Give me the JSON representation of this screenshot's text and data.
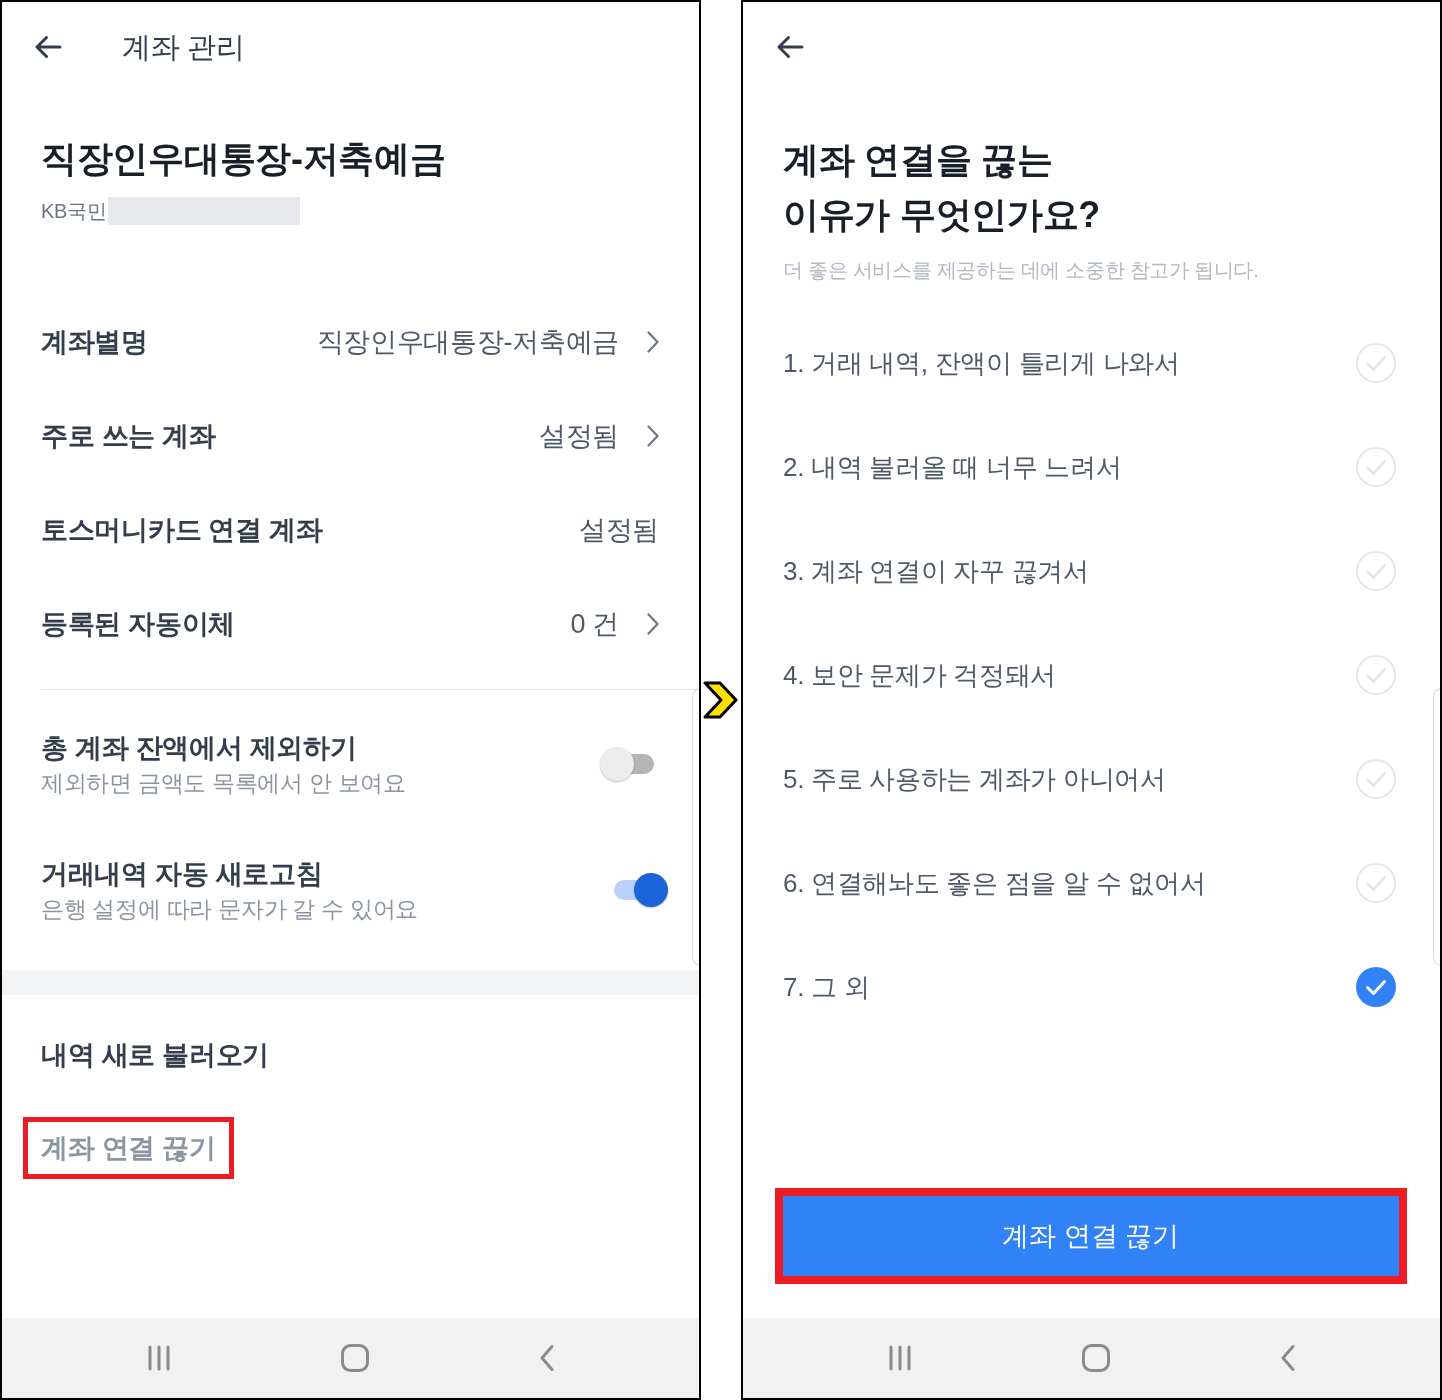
{
  "account_screen": {
    "header": {
      "title": "계좌 관리"
    },
    "account": {
      "name": "직장인우대통장-저축예금",
      "bank": "KB국민"
    },
    "settings": [
      {
        "label": "계좌별명",
        "value": "직장인우대통장-저축예금",
        "chevron": true
      },
      {
        "label": "주로 쓰는 계좌",
        "value": "설정됨",
        "chevron": true
      },
      {
        "label": "토스머니카드 연결 계좌",
        "value": "설정됨",
        "chevron": false
      },
      {
        "label": "등록된 자동이체",
        "value": "0 건",
        "chevron": true
      }
    ],
    "toggles": [
      {
        "title": "총 계좌 잔액에서 제외하기",
        "subtitle": "제외하면 금액도 목록에서 안 보여요",
        "on": false
      },
      {
        "title": "거래내역 자동 새로고침",
        "subtitle": "은행 설정에 따라 문자가 갈 수 있어요",
        "on": true
      }
    ],
    "actions": [
      {
        "label": "내역 새로 불러오기",
        "muted": false,
        "highlighted": false
      },
      {
        "label": "계좌 연결 끊기",
        "muted": true,
        "highlighted": true
      }
    ]
  },
  "reason_screen": {
    "title": "계좌 연결을 끊는\n이유가 무엇인가요?",
    "subtitle": "더 좋은 서비스를 제공하는 데에 소중한 참고가 됩니다.",
    "reasons": [
      {
        "label": "1. 거래 내역, 잔액이 틀리게 나와서",
        "selected": false
      },
      {
        "label": "2. 내역 불러올 때 너무 느려서",
        "selected": false
      },
      {
        "label": "3. 계좌 연결이 자꾸 끊겨서",
        "selected": false
      },
      {
        "label": "4. 보안 문제가 걱정돼서",
        "selected": false
      },
      {
        "label": "5. 주로 사용하는 계좌가 아니어서",
        "selected": false
      },
      {
        "label": "6. 연결해놔도 좋은 점을 알 수 없어서",
        "selected": false
      },
      {
        "label": "7. 그 외",
        "selected": true
      }
    ],
    "submit": {
      "label": "계좌 연결 끊기",
      "highlighted": true
    }
  }
}
